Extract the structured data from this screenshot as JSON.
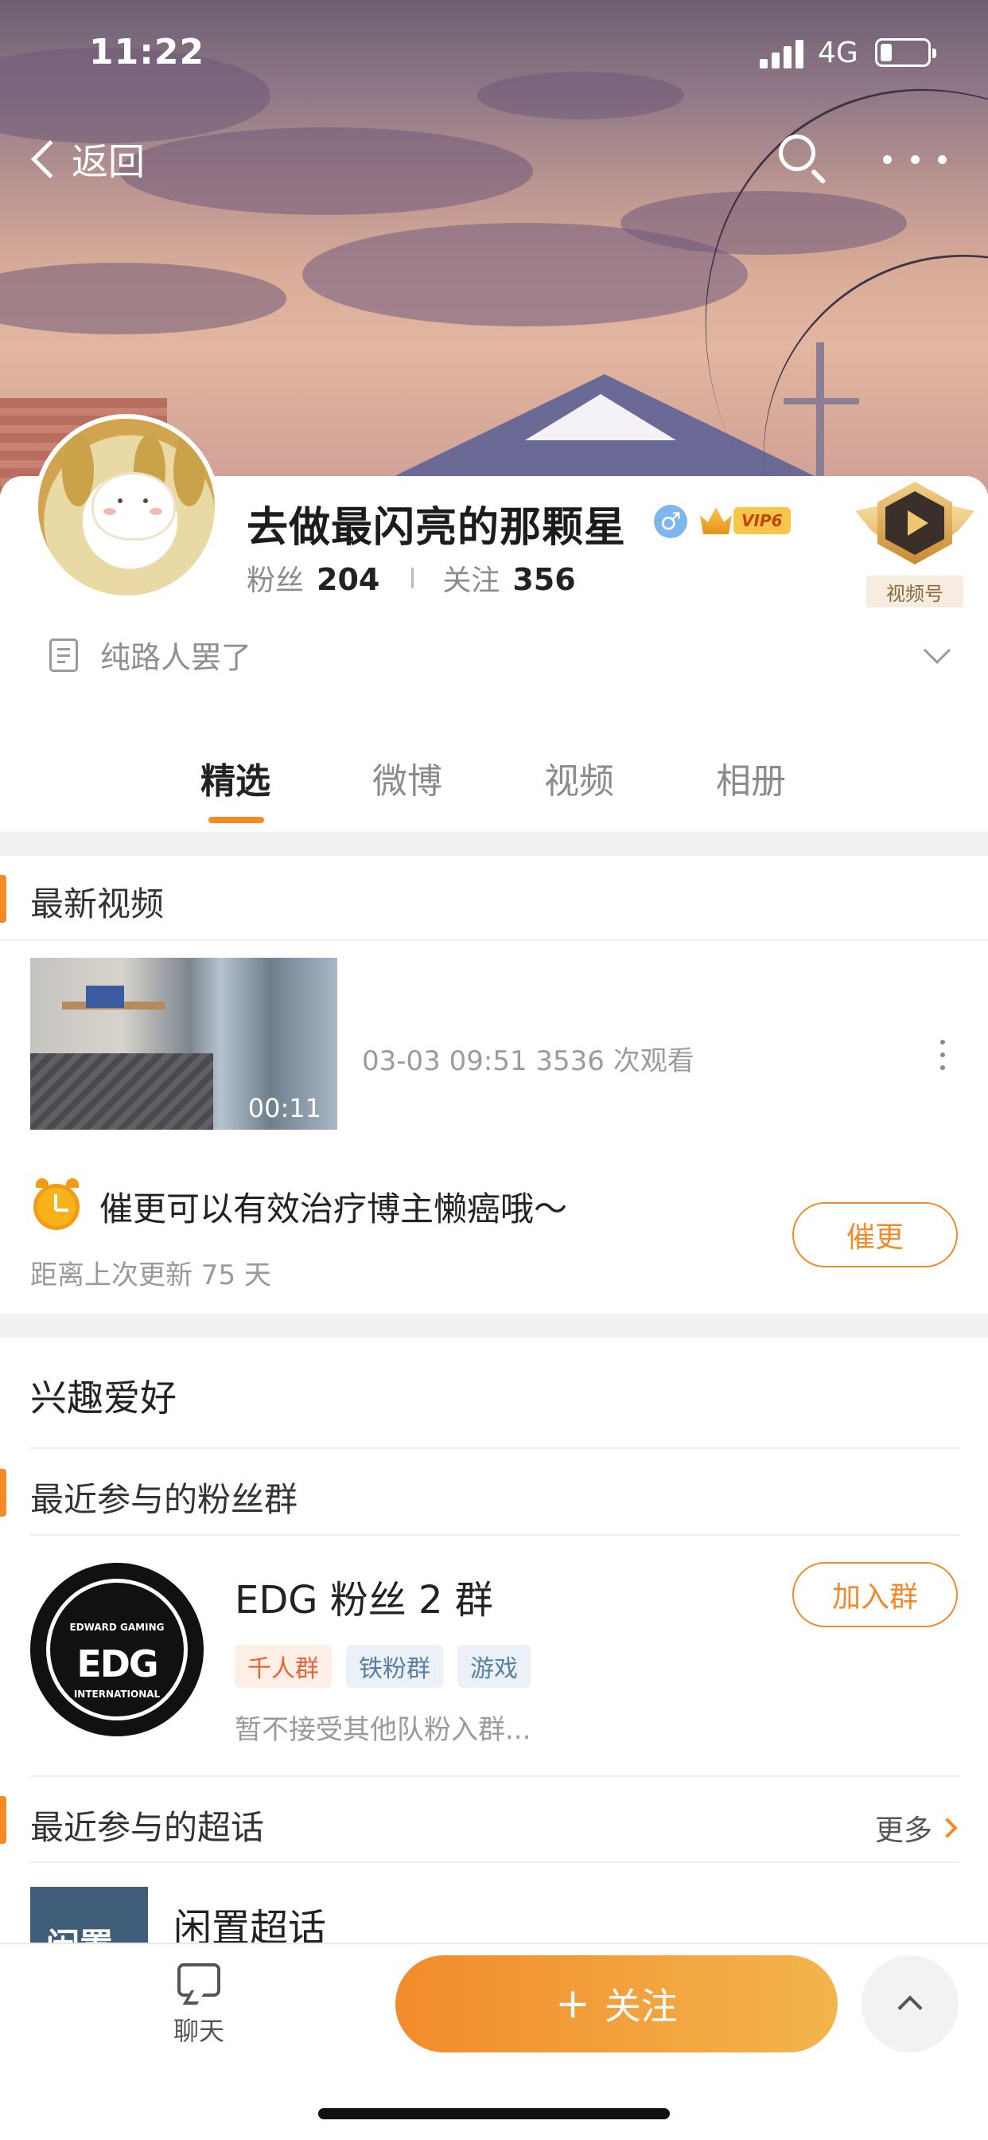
{
  "status_bar": {
    "time": "11:22",
    "network": "4G"
  },
  "nav": {
    "back_label": "返回"
  },
  "profile": {
    "name": "去做最闪亮的那颗星",
    "gender_symbol": "♂",
    "vip_label": "VIP6",
    "followers_label": "粉丝",
    "followers_count": "204",
    "following_label": "关注",
    "following_count": "356",
    "video_badge_label": "视频号",
    "bio": "纯路人罢了"
  },
  "tabs": [
    {
      "label": "精选",
      "active": true
    },
    {
      "label": "微博",
      "active": false
    },
    {
      "label": "视频",
      "active": false
    },
    {
      "label": "相册",
      "active": false
    }
  ],
  "latest_video": {
    "section_title": "最新视频",
    "duration": "00:11",
    "meta": "03-03 09:51 3536 次观看"
  },
  "urge": {
    "text": "催更可以有效治疗博主懒癌哦～",
    "sub": "距离上次更新 75 天",
    "button": "催更"
  },
  "interests": {
    "title": "兴趣爱好"
  },
  "fan_group": {
    "section_title": "最近参与的粉丝群",
    "logo_top": "EDWARD GAMING",
    "logo_mid": "EDG",
    "logo_bottom": "INTERNATIONAL",
    "name": "EDG 粉丝 2 群",
    "tags": [
      "千人群",
      "铁粉群",
      "游戏"
    ],
    "description": "暂不接受其他队粉入群...",
    "join_button": "加入群"
  },
  "super_topic": {
    "section_title": "最近参与的超话",
    "more_label": "更多",
    "image_text": "闲置",
    "name": "闲置超话"
  },
  "bottom_bar": {
    "chat_label": "聊天",
    "follow_plus": "+",
    "follow_label": "关注"
  },
  "colors": {
    "accent": "#f28a2a",
    "vip": "#f7c54a",
    "gender": "#7fb6ec"
  }
}
